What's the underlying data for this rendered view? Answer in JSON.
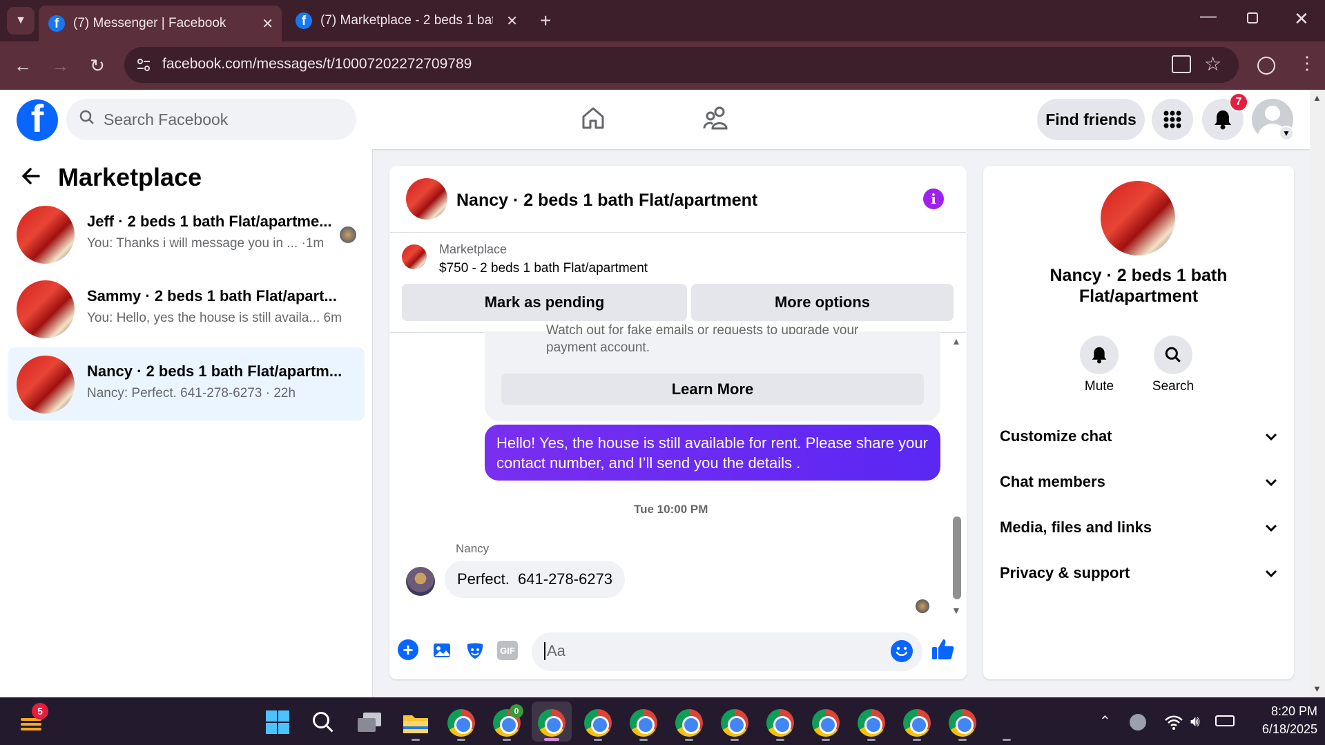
{
  "browser": {
    "tabs": [
      {
        "title": "(7) Messenger | Facebook",
        "active": true
      },
      {
        "title": "(7) Marketplace - 2 beds 1 bath",
        "active": false
      }
    ],
    "url": "facebook.com/messages/t/10007202272709789"
  },
  "fb_header": {
    "search_placeholder": "Search Facebook",
    "find_friends": "Find friends",
    "notification_count": "7"
  },
  "sidebar": {
    "title": "Marketplace",
    "conversations": [
      {
        "name": "Jeff · 2 beds 1 bath Flat/apartme...",
        "preview": "You: Thanks i will message you in ...  ·1m"
      },
      {
        "name": "Sammy · 2 beds 1 bath Flat/apart...",
        "preview": "You: Hello, yes the house is still availa... 6m"
      },
      {
        "name": "Nancy · 2 beds 1 bath Flat/apartm...",
        "preview": "Nancy: Perfect. 641-278-6273 · 22h"
      }
    ]
  },
  "chat": {
    "title": "Nancy · 2 beds 1 bath Flat/apartment",
    "listing_source": "Marketplace",
    "listing_title": "$750 - 2 beds 1 bath Flat/apartment",
    "mark_pending": "Mark as pending",
    "more_options": "More options",
    "warning_line1": "Watch out for fake emails or requests to upgrade your",
    "warning_line2": "payment account.",
    "learn_more": "Learn More",
    "outgoing_message": "Hello! Yes, the house is still available for rent. Please share your contact number, and I’ll send you the details .",
    "timestamp": "Tue 10:00 PM",
    "sender_name": "Nancy",
    "incoming_message": "Perfect.  641-278-6273",
    "composer_placeholder": "Aa",
    "gif_label": "GIF"
  },
  "details": {
    "name": "Nancy · 2 beds 1 bath Flat/apartment",
    "mute": "Mute",
    "search": "Search",
    "sections": [
      "Customize chat",
      "Chat members",
      "Media, files and links",
      "Privacy & support"
    ]
  },
  "taskbar": {
    "time": "8:20 PM",
    "date": "6/18/2025",
    "weather_badge": "5",
    "chrome_badge": "0"
  },
  "colors": {
    "fb_blue": "#0866ff",
    "messenger_purple": "#7c1ff0",
    "chrome_tab_bg": "#3c1f2a",
    "notification_red": "#e41e3f"
  }
}
